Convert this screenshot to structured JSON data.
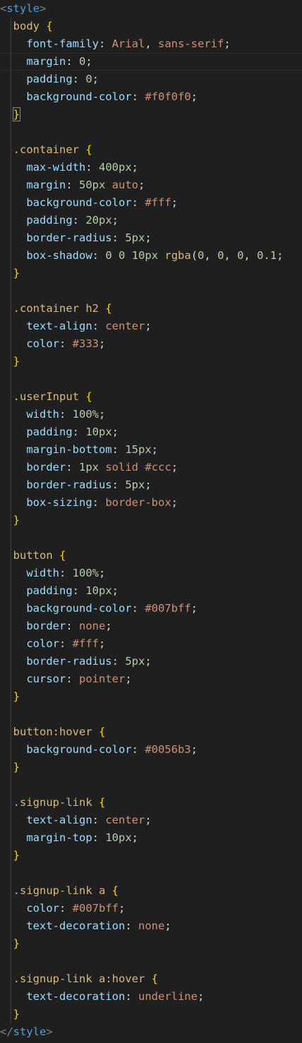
{
  "editor": {
    "open_tag": "style",
    "close_tag": "style",
    "rules": [
      {
        "selector": "body",
        "declarations": [
          {
            "prop": "font-family",
            "values": [
              [
                "val",
                "Arial"
              ],
              [
                "plain",
                ", "
              ],
              [
                "val",
                "sans-serif"
              ]
            ]
          },
          {
            "prop": "margin",
            "values": [
              [
                "num",
                "0"
              ]
            ]
          },
          {
            "prop": "padding",
            "values": [
              [
                "num",
                "0"
              ]
            ]
          },
          {
            "prop": "background-color",
            "values": [
              [
                "val",
                "#f0f0f0"
              ]
            ]
          }
        ]
      },
      {
        "selector": ".container",
        "declarations": [
          {
            "prop": "max-width",
            "values": [
              [
                "num",
                "400px"
              ]
            ]
          },
          {
            "prop": "margin",
            "values": [
              [
                "num",
                "50px"
              ],
              [
                "plain",
                " "
              ],
              [
                "val",
                "auto"
              ]
            ]
          },
          {
            "prop": "background-color",
            "values": [
              [
                "val",
                "#fff"
              ]
            ]
          },
          {
            "prop": "padding",
            "values": [
              [
                "num",
                "20px"
              ]
            ]
          },
          {
            "prop": "border-radius",
            "values": [
              [
                "num",
                "5px"
              ]
            ]
          },
          {
            "prop": "box-shadow",
            "values": [
              [
                "num",
                "0"
              ],
              [
                "plain",
                " "
              ],
              [
                "num",
                "0"
              ],
              [
                "plain",
                " "
              ],
              [
                "num",
                "10px"
              ],
              [
                "plain",
                " "
              ],
              [
                "sel",
                "rgba"
              ],
              [
                "plain",
                "("
              ],
              [
                "num",
                "0"
              ],
              [
                "plain",
                ", "
              ],
              [
                "num",
                "0"
              ],
              [
                "plain",
                ", "
              ],
              [
                "num",
                "0"
              ],
              [
                "plain",
                ", "
              ],
              [
                "num",
                "0.1"
              ]
            ]
          }
        ]
      },
      {
        "selector": ".container h2",
        "declarations": [
          {
            "prop": "text-align",
            "values": [
              [
                "val",
                "center"
              ]
            ]
          },
          {
            "prop": "color",
            "values": [
              [
                "val",
                "#333"
              ]
            ]
          }
        ]
      },
      {
        "selector": ".userInput",
        "declarations": [
          {
            "prop": "width",
            "values": [
              [
                "num",
                "100%"
              ]
            ]
          },
          {
            "prop": "padding",
            "values": [
              [
                "num",
                "10px"
              ]
            ]
          },
          {
            "prop": "margin-bottom",
            "values": [
              [
                "num",
                "15px"
              ]
            ]
          },
          {
            "prop": "border",
            "values": [
              [
                "num",
                "1px"
              ],
              [
                "plain",
                " "
              ],
              [
                "val",
                "solid"
              ],
              [
                "plain",
                " "
              ],
              [
                "val",
                "#ccc"
              ]
            ]
          },
          {
            "prop": "border-radius",
            "values": [
              [
                "num",
                "5px"
              ]
            ]
          },
          {
            "prop": "box-sizing",
            "values": [
              [
                "val",
                "border-box"
              ]
            ]
          }
        ]
      },
      {
        "selector": "button",
        "declarations": [
          {
            "prop": "width",
            "values": [
              [
                "num",
                "100%"
              ]
            ]
          },
          {
            "prop": "padding",
            "values": [
              [
                "num",
                "10px"
              ]
            ]
          },
          {
            "prop": "background-color",
            "values": [
              [
                "val",
                "#007bff"
              ]
            ]
          },
          {
            "prop": "border",
            "values": [
              [
                "val",
                "none"
              ]
            ]
          },
          {
            "prop": "color",
            "values": [
              [
                "val",
                "#fff"
              ]
            ]
          },
          {
            "prop": "border-radius",
            "values": [
              [
                "num",
                "5px"
              ]
            ]
          },
          {
            "prop": "cursor",
            "values": [
              [
                "val",
                "pointer"
              ]
            ]
          }
        ]
      },
      {
        "selector": "button:hover",
        "declarations": [
          {
            "prop": "background-color",
            "values": [
              [
                "val",
                "#0056b3"
              ]
            ]
          }
        ]
      },
      {
        "selector": ".signup-link",
        "declarations": [
          {
            "prop": "text-align",
            "values": [
              [
                "val",
                "center"
              ]
            ]
          },
          {
            "prop": "margin-top",
            "values": [
              [
                "num",
                "10px"
              ]
            ]
          }
        ]
      },
      {
        "selector": ".signup-link a",
        "declarations": [
          {
            "prop": "color",
            "values": [
              [
                "val",
                "#007bff"
              ]
            ]
          },
          {
            "prop": "text-decoration",
            "values": [
              [
                "val",
                "none"
              ]
            ]
          }
        ]
      },
      {
        "selector": ".signup-link a:hover",
        "declarations": [
          {
            "prop": "text-decoration",
            "values": [
              [
                "val",
                "underline"
              ]
            ]
          }
        ]
      }
    ]
  },
  "colors": {
    "background": "#1f1f1f",
    "tag": "#569cd6",
    "selector": "#d7ba7d",
    "brace": "#ffd700",
    "property": "#9cdcfe",
    "value_keyword": "#ce9178",
    "value_number": "#b5cea8"
  }
}
